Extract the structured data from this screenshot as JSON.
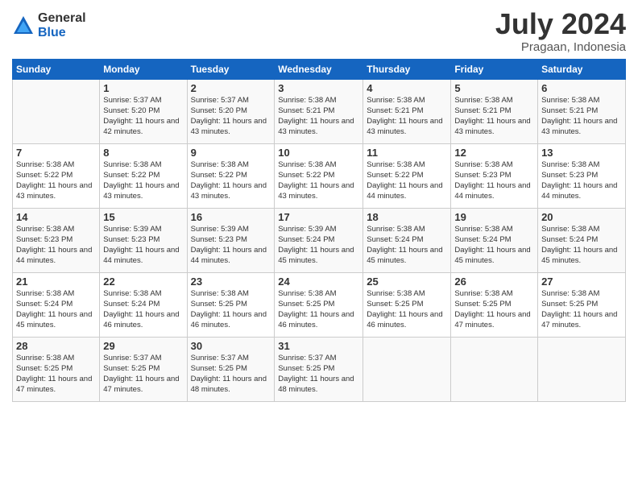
{
  "logo": {
    "general": "General",
    "blue": "Blue"
  },
  "title": "July 2024",
  "location": "Pragaan, Indonesia",
  "days_header": [
    "Sunday",
    "Monday",
    "Tuesday",
    "Wednesday",
    "Thursday",
    "Friday",
    "Saturday"
  ],
  "weeks": [
    [
      {
        "day": "",
        "sunrise": "",
        "sunset": "",
        "daylight": ""
      },
      {
        "day": "1",
        "sunrise": "Sunrise: 5:37 AM",
        "sunset": "Sunset: 5:20 PM",
        "daylight": "Daylight: 11 hours and 42 minutes."
      },
      {
        "day": "2",
        "sunrise": "Sunrise: 5:37 AM",
        "sunset": "Sunset: 5:20 PM",
        "daylight": "Daylight: 11 hours and 43 minutes."
      },
      {
        "day": "3",
        "sunrise": "Sunrise: 5:38 AM",
        "sunset": "Sunset: 5:21 PM",
        "daylight": "Daylight: 11 hours and 43 minutes."
      },
      {
        "day": "4",
        "sunrise": "Sunrise: 5:38 AM",
        "sunset": "Sunset: 5:21 PM",
        "daylight": "Daylight: 11 hours and 43 minutes."
      },
      {
        "day": "5",
        "sunrise": "Sunrise: 5:38 AM",
        "sunset": "Sunset: 5:21 PM",
        "daylight": "Daylight: 11 hours and 43 minutes."
      },
      {
        "day": "6",
        "sunrise": "Sunrise: 5:38 AM",
        "sunset": "Sunset: 5:21 PM",
        "daylight": "Daylight: 11 hours and 43 minutes."
      }
    ],
    [
      {
        "day": "7",
        "sunrise": "Sunrise: 5:38 AM",
        "sunset": "Sunset: 5:22 PM",
        "daylight": "Daylight: 11 hours and 43 minutes."
      },
      {
        "day": "8",
        "sunrise": "Sunrise: 5:38 AM",
        "sunset": "Sunset: 5:22 PM",
        "daylight": "Daylight: 11 hours and 43 minutes."
      },
      {
        "day": "9",
        "sunrise": "Sunrise: 5:38 AM",
        "sunset": "Sunset: 5:22 PM",
        "daylight": "Daylight: 11 hours and 43 minutes."
      },
      {
        "day": "10",
        "sunrise": "Sunrise: 5:38 AM",
        "sunset": "Sunset: 5:22 PM",
        "daylight": "Daylight: 11 hours and 43 minutes."
      },
      {
        "day": "11",
        "sunrise": "Sunrise: 5:38 AM",
        "sunset": "Sunset: 5:22 PM",
        "daylight": "Daylight: 11 hours and 44 minutes."
      },
      {
        "day": "12",
        "sunrise": "Sunrise: 5:38 AM",
        "sunset": "Sunset: 5:23 PM",
        "daylight": "Daylight: 11 hours and 44 minutes."
      },
      {
        "day": "13",
        "sunrise": "Sunrise: 5:38 AM",
        "sunset": "Sunset: 5:23 PM",
        "daylight": "Daylight: 11 hours and 44 minutes."
      }
    ],
    [
      {
        "day": "14",
        "sunrise": "Sunrise: 5:38 AM",
        "sunset": "Sunset: 5:23 PM",
        "daylight": "Daylight: 11 hours and 44 minutes."
      },
      {
        "day": "15",
        "sunrise": "Sunrise: 5:39 AM",
        "sunset": "Sunset: 5:23 PM",
        "daylight": "Daylight: 11 hours and 44 minutes."
      },
      {
        "day": "16",
        "sunrise": "Sunrise: 5:39 AM",
        "sunset": "Sunset: 5:23 PM",
        "daylight": "Daylight: 11 hours and 44 minutes."
      },
      {
        "day": "17",
        "sunrise": "Sunrise: 5:39 AM",
        "sunset": "Sunset: 5:24 PM",
        "daylight": "Daylight: 11 hours and 45 minutes."
      },
      {
        "day": "18",
        "sunrise": "Sunrise: 5:38 AM",
        "sunset": "Sunset: 5:24 PM",
        "daylight": "Daylight: 11 hours and 45 minutes."
      },
      {
        "day": "19",
        "sunrise": "Sunrise: 5:38 AM",
        "sunset": "Sunset: 5:24 PM",
        "daylight": "Daylight: 11 hours and 45 minutes."
      },
      {
        "day": "20",
        "sunrise": "Sunrise: 5:38 AM",
        "sunset": "Sunset: 5:24 PM",
        "daylight": "Daylight: 11 hours and 45 minutes."
      }
    ],
    [
      {
        "day": "21",
        "sunrise": "Sunrise: 5:38 AM",
        "sunset": "Sunset: 5:24 PM",
        "daylight": "Daylight: 11 hours and 45 minutes."
      },
      {
        "day": "22",
        "sunrise": "Sunrise: 5:38 AM",
        "sunset": "Sunset: 5:24 PM",
        "daylight": "Daylight: 11 hours and 46 minutes."
      },
      {
        "day": "23",
        "sunrise": "Sunrise: 5:38 AM",
        "sunset": "Sunset: 5:25 PM",
        "daylight": "Daylight: 11 hours and 46 minutes."
      },
      {
        "day": "24",
        "sunrise": "Sunrise: 5:38 AM",
        "sunset": "Sunset: 5:25 PM",
        "daylight": "Daylight: 11 hours and 46 minutes."
      },
      {
        "day": "25",
        "sunrise": "Sunrise: 5:38 AM",
        "sunset": "Sunset: 5:25 PM",
        "daylight": "Daylight: 11 hours and 46 minutes."
      },
      {
        "day": "26",
        "sunrise": "Sunrise: 5:38 AM",
        "sunset": "Sunset: 5:25 PM",
        "daylight": "Daylight: 11 hours and 47 minutes."
      },
      {
        "day": "27",
        "sunrise": "Sunrise: 5:38 AM",
        "sunset": "Sunset: 5:25 PM",
        "daylight": "Daylight: 11 hours and 47 minutes."
      }
    ],
    [
      {
        "day": "28",
        "sunrise": "Sunrise: 5:38 AM",
        "sunset": "Sunset: 5:25 PM",
        "daylight": "Daylight: 11 hours and 47 minutes."
      },
      {
        "day": "29",
        "sunrise": "Sunrise: 5:37 AM",
        "sunset": "Sunset: 5:25 PM",
        "daylight": "Daylight: 11 hours and 47 minutes."
      },
      {
        "day": "30",
        "sunrise": "Sunrise: 5:37 AM",
        "sunset": "Sunset: 5:25 PM",
        "daylight": "Daylight: 11 hours and 48 minutes."
      },
      {
        "day": "31",
        "sunrise": "Sunrise: 5:37 AM",
        "sunset": "Sunset: 5:25 PM",
        "daylight": "Daylight: 11 hours and 48 minutes."
      },
      {
        "day": "",
        "sunrise": "",
        "sunset": "",
        "daylight": ""
      },
      {
        "day": "",
        "sunrise": "",
        "sunset": "",
        "daylight": ""
      },
      {
        "day": "",
        "sunrise": "",
        "sunset": "",
        "daylight": ""
      }
    ]
  ]
}
